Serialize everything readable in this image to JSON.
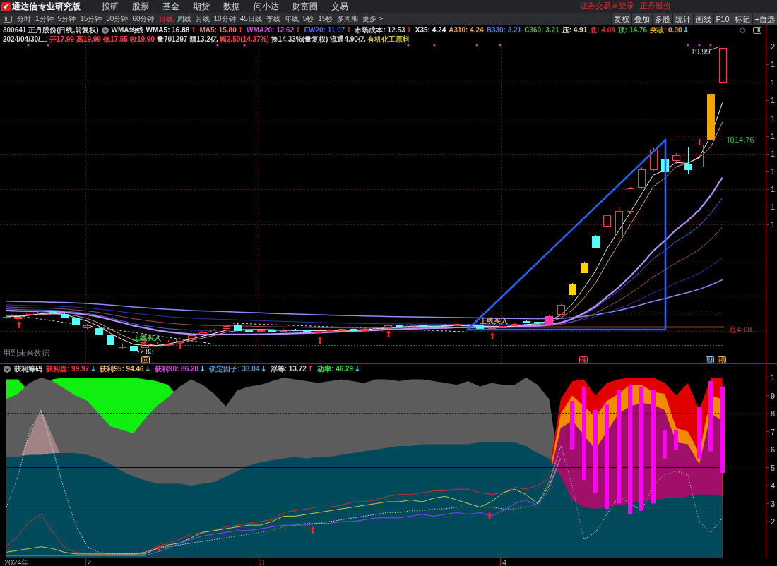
{
  "title_bar": {
    "app_name": "通达信专业研究版",
    "menu": [
      "投研",
      "股票",
      "基金",
      "期货",
      "数据",
      "问小达",
      "财富圈",
      "交易"
    ],
    "login_status": "证券交易未登录",
    "stock_name": "正丹股份"
  },
  "period_tabs": [
    {
      "label": "分时",
      "selected": false
    },
    {
      "label": "1分钟",
      "selected": false
    },
    {
      "label": "5分钟",
      "selected": false
    },
    {
      "label": "15分钟",
      "selected": false
    },
    {
      "label": "30分钟",
      "selected": false
    },
    {
      "label": "60分钟",
      "selected": false
    },
    {
      "label": "日线",
      "selected": true
    },
    {
      "label": "周线",
      "selected": false
    },
    {
      "label": "月线",
      "selected": false
    },
    {
      "label": "10分钟",
      "selected": false
    },
    {
      "label": "45日线",
      "selected": false
    },
    {
      "label": "季线",
      "selected": false
    },
    {
      "label": "年线",
      "selected": false
    },
    {
      "label": "5秒",
      "selected": false
    },
    {
      "label": "15秒",
      "selected": false
    },
    {
      "label": "多周期",
      "selected": false
    },
    {
      "label": "更多 >",
      "selected": false
    }
  ],
  "tool_buttons": [
    "复权",
    "叠加",
    "多股",
    "统计",
    "画线",
    "F10",
    "标记",
    "+自选"
  ],
  "main_chart": {
    "security": "300641 正丹股份(日线,前复权)",
    "indicator": "WMA均线",
    "indicator_values": [
      {
        "text": "WMA5: 16.88",
        "color": "#e8e8e8",
        "arrow": {
          "text": "↑",
          "kind": "up"
        }
      },
      {
        "text": "MA5: 15.80",
        "color": "#ff7070",
        "arrow": {
          "text": "↑",
          "kind": "up"
        }
      },
      {
        "text": "WMA20: 12.62",
        "color": "#d050e0",
        "arrow": {
          "text": "↑",
          "kind": "up"
        }
      },
      {
        "text": "EW20: 11.07",
        "color": "#4868f0",
        "arrow": {
          "text": "↑",
          "kind": "up"
        }
      },
      {
        "text": "市场成本: 12.53",
        "color": "#d8d8d8",
        "arrow": {
          "text": "↑",
          "kind": "up"
        }
      },
      {
        "text": "X35: 4.24",
        "color": "#f0f0f0"
      },
      {
        "text": "A310: 4.24",
        "color": "#f0a050"
      },
      {
        "text": "B330: 3.21",
        "color": "#4a7cf0"
      },
      {
        "text": "C360: 3.21",
        "color": "#50c050"
      },
      {
        "text": "压: 4.91",
        "color": "#e8e0a0"
      },
      {
        "text": "底: 4.08",
        "color": "#e03030"
      },
      {
        "text": "顶: 14.76",
        "color": "#40c040"
      },
      {
        "text": "突破: 0.00",
        "color": "#e0b020",
        "arrow": {
          "text": "↓",
          "kind": "down"
        }
      }
    ],
    "quote": [
      {
        "text": "2024/04/30/二",
        "color": "#e0e0e0"
      },
      {
        "text": "开17.99",
        "color": "#ff4040"
      },
      {
        "text": "高19.99",
        "color": "#ff4040"
      },
      {
        "text": "低17.55",
        "color": "#ff4040"
      },
      {
        "text": "收19.90",
        "color": "#ff4040"
      },
      {
        "text": "量701297",
        "color": "#d8d8d8"
      },
      {
        "text": "额13.2亿",
        "color": "#d8d8d8"
      },
      {
        "text": "幅2.50(14.37%)",
        "color": "#ff4040"
      },
      {
        "text": "换14.33%(量复权)",
        "color": "#d8d8d8"
      },
      {
        "text": "流通4.90亿",
        "color": "#d8d8d8"
      },
      {
        "text": "有机化工原料",
        "color": "#c8c040"
      }
    ],
    "future_data_note": "用到未来数据",
    "buy_signals": [
      {
        "text": "上线买入",
        "color": "#50c850"
      },
      {
        "text": "上线买入",
        "color": "#d8a870"
      }
    ],
    "low_label": "2.83",
    "high_label": "19.99",
    "top_level": "顶14.76",
    "bottom_level": "底4.08",
    "badges": [
      {
        "text": "回",
        "color": "#e8c060"
      },
      {
        "text": "涨",
        "color": "#ff4040"
      },
      {
        "text": "财",
        "color": "#80c8ff"
      },
      {
        "text": "榜",
        "color": "#f0a040"
      }
    ],
    "price_axis": [
      "2",
      "1",
      "1",
      "1",
      "1",
      "1",
      "1",
      "1",
      "1",
      "1",
      "1"
    ]
  },
  "sub_chart": {
    "indicator": "获利筹码",
    "indicator_values": [
      {
        "text": "获利盘: 99.97",
        "color": "#ff3030",
        "arrow": {
          "text": "↓",
          "kind": "down"
        }
      },
      {
        "text": "获利95: 94.46",
        "color": "#f0c070",
        "arrow": {
          "text": "↓",
          "kind": "down"
        }
      },
      {
        "text": "获利90: 86.28",
        "color": "#d050e0",
        "arrow": {
          "text": "↓",
          "kind": "down"
        }
      },
      {
        "text": "锁定因子: 33.04",
        "color": "#5a90c0",
        "arrow": {
          "text": "↓",
          "kind": "down"
        }
      },
      {
        "text": "浮筹: 13.72",
        "color": "#d8d8d8",
        "arrow": {
          "text": "↑",
          "kind": "up"
        }
      },
      {
        "text": "动率: 46.29",
        "color": "#40e040",
        "arrow": {
          "text": "↓",
          "kind": "down"
        }
      }
    ],
    "value_axis": [
      "1",
      "9",
      "8",
      "7",
      "6",
      "5",
      "4",
      "3",
      "2"
    ]
  },
  "time_axis": [
    "2024年",
    "2",
    "3",
    "4"
  ]
}
